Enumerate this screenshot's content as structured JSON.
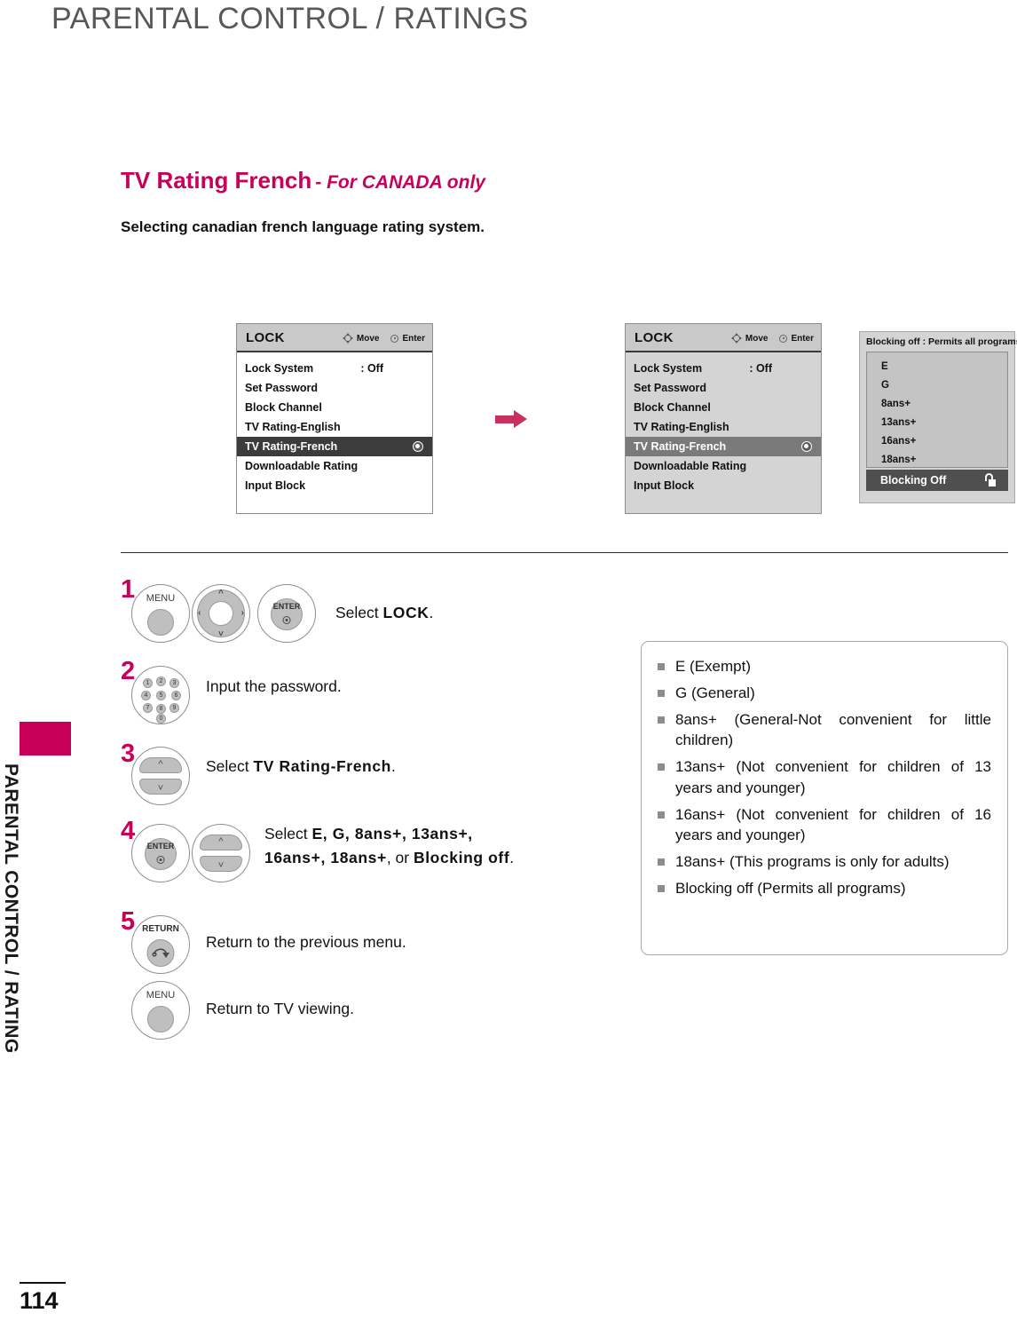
{
  "header": {
    "title": "PARENTAL CONTROL / RATINGS"
  },
  "sidebar": {
    "vertical_label": "PARENTAL CONTROL / RATING",
    "tab_color": "#c8005a"
  },
  "footer": {
    "page_number": "114"
  },
  "section": {
    "heading_main": "TV Rating French",
    "heading_sub": "- For CANADA only",
    "subtitle": "Selecting canadian french language rating system.",
    "accent_color": "#c8005a"
  },
  "osd_panel_a": {
    "title": "LOCK",
    "hint_move": "Move",
    "hint_enter": "Enter",
    "rows": [
      {
        "label": "Lock System",
        "value": ": Off",
        "selected": false
      },
      {
        "label": "Set Password",
        "value": "",
        "selected": false
      },
      {
        "label": "Block Channel",
        "value": "",
        "selected": false
      },
      {
        "label": "TV Rating-English",
        "value": "",
        "selected": false
      },
      {
        "label": "TV Rating-French",
        "value": "",
        "selected": true
      },
      {
        "label": "Downloadable Rating",
        "value": "",
        "selected": false
      },
      {
        "label": "Input Block",
        "value": "",
        "selected": false
      }
    ]
  },
  "osd_panel_b": {
    "title": "LOCK",
    "hint_move": "Move",
    "hint_enter": "Enter",
    "rows": [
      {
        "label": "Lock System",
        "value": ": Off",
        "selected": false
      },
      {
        "label": "Set Password",
        "value": "",
        "selected": false
      },
      {
        "label": "Block Channel",
        "value": "",
        "selected": false
      },
      {
        "label": "TV Rating-English",
        "value": "",
        "selected": false
      },
      {
        "label": "TV Rating-French",
        "value": "",
        "selected": true
      },
      {
        "label": "Downloadable Rating",
        "value": "",
        "selected": false
      },
      {
        "label": "Input Block",
        "value": "",
        "selected": false
      }
    ]
  },
  "rating_panel": {
    "caption": "Blocking off : Permits all programs",
    "items": [
      "E",
      "G",
      "8ans+",
      "13ans+",
      "16ans+",
      "18ans+"
    ],
    "selected_label": "Blocking Off",
    "lock_icon": "unlocked-padlock-icon"
  },
  "steps": [
    {
      "number": "1",
      "buttons": [
        "menu-button",
        "navigation-wheel",
        "enter-button"
      ],
      "menu_label": "MENU",
      "enter_label": "ENTER",
      "text_prefix": "Select ",
      "text_bold": "LOCK",
      "text_suffix": "."
    },
    {
      "number": "2",
      "buttons": [
        "number-keypad"
      ],
      "keys": [
        "1",
        "2",
        "3",
        "4",
        "5",
        "6",
        "7",
        "8",
        "9",
        "0"
      ],
      "text": "Input the password."
    },
    {
      "number": "3",
      "buttons": [
        "up-down-rocker"
      ],
      "text_prefix": "Select ",
      "text_bold": "TV Rating-French",
      "text_suffix": "."
    },
    {
      "number": "4",
      "buttons": [
        "enter-button",
        "up-down-rocker"
      ],
      "enter_label": "ENTER",
      "line1_prefix": "Select ",
      "line1_bold": "E, G, 8ans+, 13ans+,",
      "line2_bold_a": "16ans+, 18ans+",
      "line2_mid": ", or ",
      "line2_bold_b": "Blocking off",
      "line2_suffix": "."
    },
    {
      "number": "5",
      "buttons": [
        "return-button"
      ],
      "return_label": "RETURN",
      "text": "Return to the previous menu."
    },
    {
      "number": "",
      "buttons": [
        "menu-button"
      ],
      "menu_label": "MENU",
      "text": "Return to TV viewing."
    }
  ],
  "info_box": {
    "items": [
      "E (Exempt)",
      "G (General)",
      "8ans+ (General-Not convenient for little children)",
      "13ans+ (Not convenient for children of 13 years and younger)",
      "16ans+ (Not convenient for children of 16 years and younger)",
      "18ans+ (This programs is only for adults)",
      "Blocking off (Permits all programs)"
    ]
  }
}
